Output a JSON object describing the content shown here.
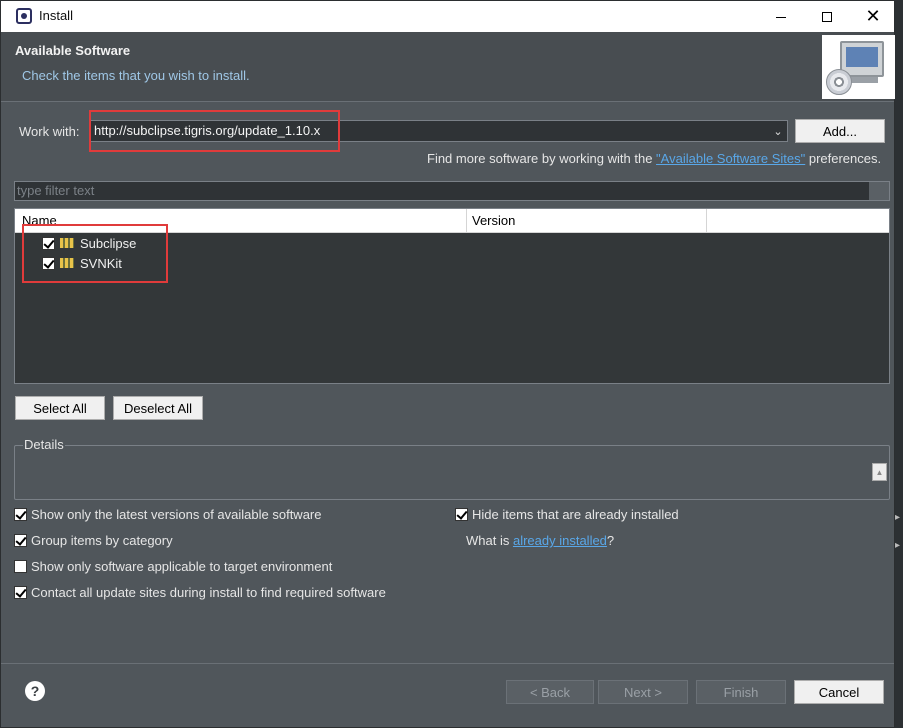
{
  "window": {
    "title": "Install"
  },
  "banner": {
    "title": "Available Software",
    "subtitle": "Check the items that you wish to install."
  },
  "work_with": {
    "label": "Work with:",
    "value": "http://subclipse.tigris.org/update_1.10.x",
    "add_button": "Add..."
  },
  "find_more": {
    "prefix": "Find more software by working with the ",
    "link": "\"Available Software Sites\"",
    "suffix": " preferences."
  },
  "filter": {
    "placeholder": "type filter text"
  },
  "tree": {
    "columns": [
      "Name",
      "Version"
    ],
    "items": [
      {
        "name": "Subclipse",
        "checked": true
      },
      {
        "name": "SVNKit",
        "checked": true
      }
    ]
  },
  "selection_buttons": {
    "select_all": "Select All",
    "deselect_all": "Deselect All"
  },
  "details": {
    "label": "Details"
  },
  "options": {
    "latest_versions": {
      "label": "Show only the latest versions of available software",
      "checked": true
    },
    "group_by_category": {
      "label": "Group items by category",
      "checked": true
    },
    "target_env": {
      "label": "Show only software applicable to target environment",
      "checked": false
    },
    "contact_sites": {
      "label": "Contact all update sites during install to find required software",
      "checked": true
    },
    "hide_installed": {
      "label": "Hide items that are already installed",
      "checked": true
    }
  },
  "what_is": {
    "prefix": "What is ",
    "link": "already installed",
    "suffix": "?"
  },
  "footer": {
    "back": "< Back",
    "next": "Next >",
    "finish": "Finish",
    "cancel": "Cancel"
  },
  "colors": {
    "background": "#50565b",
    "link": "#59a7e8",
    "highlight": "#e03b3b"
  }
}
